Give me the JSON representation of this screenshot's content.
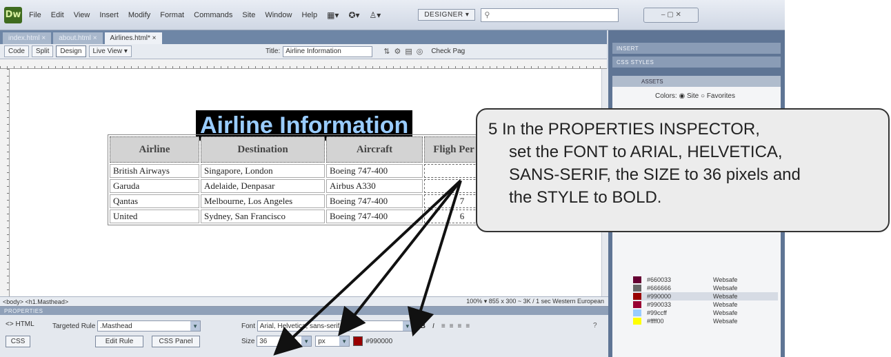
{
  "menubar": {
    "logo": "Dw",
    "items": [
      "File",
      "Edit",
      "View",
      "Insert",
      "Modify",
      "Format",
      "Commands",
      "Site",
      "Window",
      "Help"
    ],
    "workspace": "DESIGNER",
    "workspace_arrow": "▾",
    "search_icon": "search-icon"
  },
  "doctabs": {
    "tabs": [
      "index.html",
      "about.html",
      "Airlines.html*"
    ],
    "active_index": 2,
    "close_glyph": "×"
  },
  "toolbar": {
    "code": "Code",
    "split": "Split",
    "design": "Design",
    "live_view": "Live View",
    "title_label": "Title:",
    "title_value": "Airline Information",
    "check_page": "Check Pag"
  },
  "canvas": {
    "heading": "Airline Information",
    "table": {
      "headers": [
        "Airline",
        "Destination",
        "Aircraft",
        "Fligh Per We"
      ],
      "rows": [
        [
          "British Airways",
          "Singapore, London",
          "Boeing 747-400",
          ""
        ],
        [
          "Garuda",
          "Adelaide, Denpasar",
          "Airbus A330",
          ""
        ],
        [
          "Qantas",
          "Melbourne, Los Angeles",
          "Boeing 747-400",
          "7"
        ],
        [
          "United",
          "Sydney, San Francisco",
          "Boeing 747-400",
          "6"
        ]
      ]
    }
  },
  "statusbar": {
    "tags": "<body> <h1.Masthead>",
    "zoom": "100%",
    "info": "855 x 300 ~ 3K / 1 sec  Western European"
  },
  "properties": {
    "title": "PROPERTIES",
    "html_label": "HTML",
    "css_label": "CSS",
    "targeted_rule_label": "Targeted Rule",
    "targeted_rule_value": ".Masthead",
    "edit_rule": "Edit Rule",
    "css_panel": "CSS Panel",
    "font_label": "Font",
    "font_value": "Arial, Helvetica, sans-serif",
    "size_label": "Size",
    "size_value": "36",
    "unit_value": "px",
    "color_value": "#990000",
    "bold_glyph": "B",
    "italic_glyph": "I"
  },
  "panels": {
    "insert": "INSERT",
    "css_styles": "CSS STYLES",
    "assets": "ASSETS",
    "colors_label": "Colors:",
    "site_label": "Site",
    "favorites_label": "Favorites",
    "swatches": [
      {
        "code": "#660033",
        "type": "Websafe",
        "color": "#660033"
      },
      {
        "code": "#666666",
        "type": "Websafe",
        "color": "#666666"
      },
      {
        "code": "#990000",
        "type": "Websafe",
        "color": "#990000"
      },
      {
        "code": "#990033",
        "type": "Websafe",
        "color": "#990033"
      },
      {
        "code": "#99ccff",
        "type": "Websafe",
        "color": "#99ccff"
      },
      {
        "code": "#ffff00",
        "type": "Websafe",
        "color": "#ffff00"
      }
    ],
    "selected_swatch": 2
  },
  "callout": {
    "lines": [
      "5  In the PROPERTIES INSPECTOR,",
      "set the FONT to ARIAL, HELVETICA,",
      "SANS-SERIF, the SIZE to 36 pixels and",
      "the STYLE to BOLD."
    ]
  }
}
